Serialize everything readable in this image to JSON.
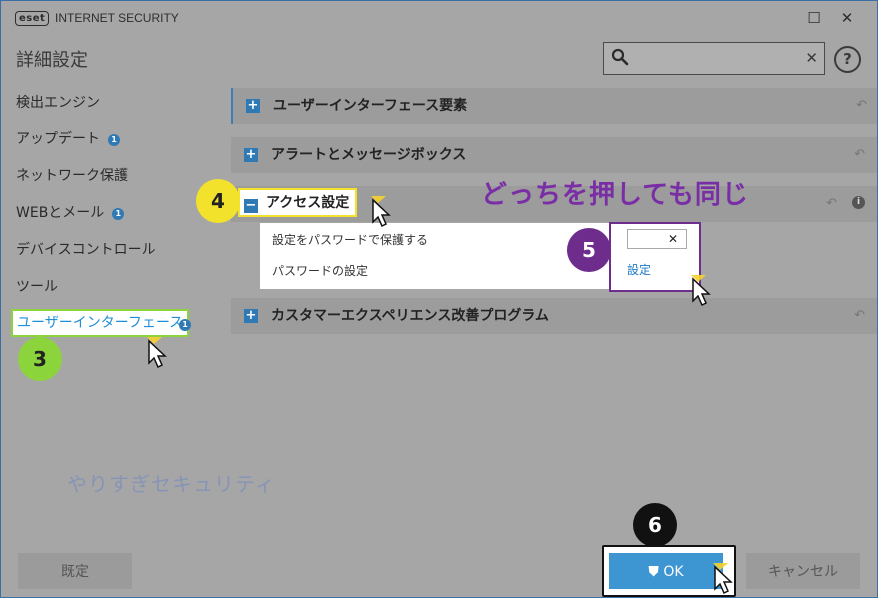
{
  "window": {
    "logo_text": "eset",
    "app_title": "INTERNET SECURITY",
    "minimize_glyph": "☐",
    "close_glyph": "✕"
  },
  "page_title": "詳細設定",
  "search": {
    "value": "",
    "placeholder": "",
    "clear_glyph": "✕"
  },
  "help_glyph": "?",
  "sidebar": {
    "items": [
      {
        "label": "検出エンジン",
        "badge": ""
      },
      {
        "label": "アップデート",
        "badge": "1"
      },
      {
        "label": "ネットワーク保護",
        "badge": ""
      },
      {
        "label": "WEBとメール",
        "badge": "1"
      },
      {
        "label": "デバイスコントロール",
        "badge": ""
      },
      {
        "label": "ツール",
        "badge": ""
      },
      {
        "label": "ユーザーインターフェース",
        "badge": "1"
      }
    ],
    "active_index": 6
  },
  "sections": [
    {
      "label": "ユーザーインターフェース要素",
      "expand_glyph": "+",
      "expanded": false
    },
    {
      "label": "アラートとメッセージボックス",
      "expand_glyph": "+",
      "expanded": false
    },
    {
      "label": "アクセス設定",
      "expand_glyph": "−",
      "expanded": true
    },
    {
      "label": "カスタマーエクスペリエンス改善プログラム",
      "expand_glyph": "+",
      "expanded": false
    }
  ],
  "access_settings": {
    "rows": [
      {
        "label": "設定をパスワードで保護する"
      },
      {
        "label": "パスワードの設定"
      }
    ],
    "toggle_glyph": "✕",
    "toggle_on": false,
    "set_link": "設定"
  },
  "annotations": {
    "caption": "どっちを押しても同じ",
    "steps": [
      "3",
      "4",
      "5",
      "6"
    ]
  },
  "watermark": "やりすぎセキュリティ",
  "footer": {
    "default_label": "既定",
    "ok_label": "OK",
    "cancel_label": "キャンセル"
  },
  "colors": {
    "accent_blue": "#2f7ab5",
    "ok_blue": "#3d95d1",
    "step3_green": "#8bd43c",
    "step4_yellow": "#f2e22c",
    "step5_purple": "#6e2d8c",
    "caption_purple": "#7a2ea6"
  },
  "icons": {
    "search": "search-icon",
    "help": "help-icon",
    "undo": "undo-icon",
    "info": "info-icon",
    "shield": "shield-icon",
    "cursor": "cursor-icon"
  }
}
